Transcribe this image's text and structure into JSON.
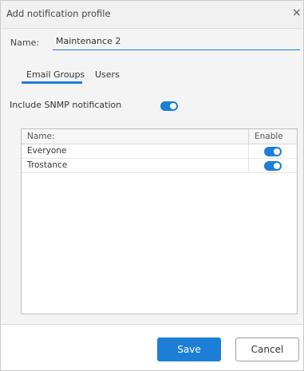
{
  "dialog": {
    "title": "Add notification profile",
    "close_symbol": "×"
  },
  "name_field": {
    "label": "Name:",
    "value": "Maintenance 2"
  },
  "tabs": [
    {
      "label": "Email Groups",
      "active": true
    },
    {
      "label": "Users",
      "active": false
    }
  ],
  "snmp": {
    "label": "Include SNMP notification",
    "enabled": true
  },
  "table": {
    "columns": [
      "Name:",
      "Enable"
    ],
    "rows": [
      {
        "name": "Everyone",
        "enabled": true
      },
      {
        "name": "Trostance",
        "enabled": true
      }
    ]
  },
  "buttons": {
    "save_label": "Save",
    "cancel_label": "Cancel"
  },
  "colors": {
    "accent": "#1c7ed6",
    "panel_bg": "#f4f4f4",
    "titlebar_bg": "#f1f1f1"
  }
}
